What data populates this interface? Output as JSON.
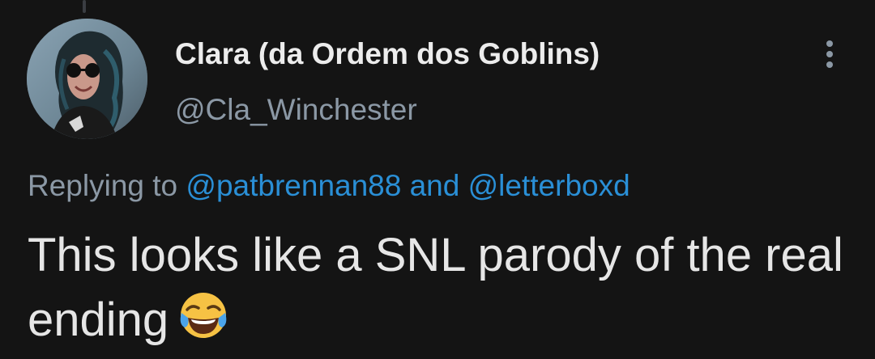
{
  "tweet": {
    "display_name": "Clara (da Ordem dos Goblins)",
    "handle": "@Cla_Winchester",
    "more_icon": "more-vertical-icon",
    "avatar_icon": "user-avatar",
    "reply": {
      "prefix": "Replying to",
      "mention_1": "@patbrennan88",
      "conjunction": "and",
      "mention_2": "@letterboxd"
    },
    "text": "This looks like a SNL parody of the real ending",
    "emoji": "face-with-tears-of-joy"
  },
  "colors": {
    "background": "#141414",
    "text": "#e6e6e6",
    "muted": "#8b98a5",
    "link": "#2a8fd6"
  }
}
